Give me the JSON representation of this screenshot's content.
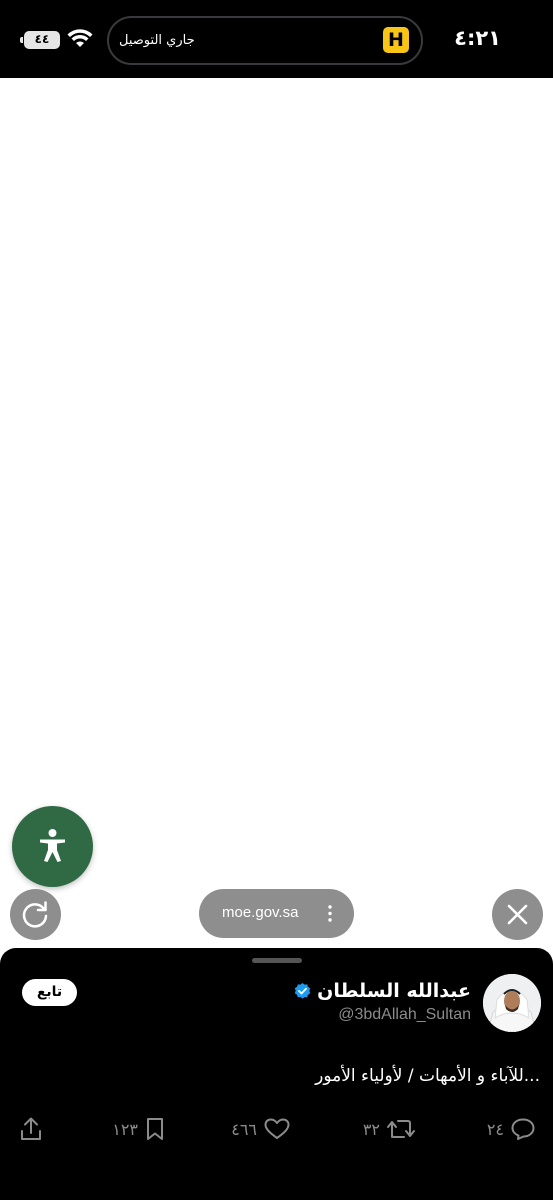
{
  "status_bar": {
    "time": "٤:٢١",
    "battery": "٤٤",
    "battery_level_percent": 44,
    "island_text": "جاري التوصيل",
    "island_app_letter": "H",
    "colors": {
      "island_logo": "#f7c518"
    }
  },
  "browser": {
    "url": "moe.gov.sa",
    "icons": {
      "accessibility": "accessibility-icon",
      "reload": "reload-icon",
      "more": "more-vertical-icon",
      "close": "close-icon"
    },
    "colors": {
      "accessibility_button": "#2f6a44",
      "control_gray": "#8e8e8e"
    }
  },
  "tweet": {
    "display_name": "عبدالله السلطان",
    "handle": "@3bdAllah_Sultan",
    "follow_label": "تابع",
    "text": "للآباء و الأمهات / لأولياء الأمور...",
    "actions": {
      "replies": "٢٤",
      "retweets": "٣٢",
      "likes": "٤٦٦",
      "bookmarks": "١٢٣"
    },
    "colors": {
      "verified": "#1d9bf0"
    }
  }
}
